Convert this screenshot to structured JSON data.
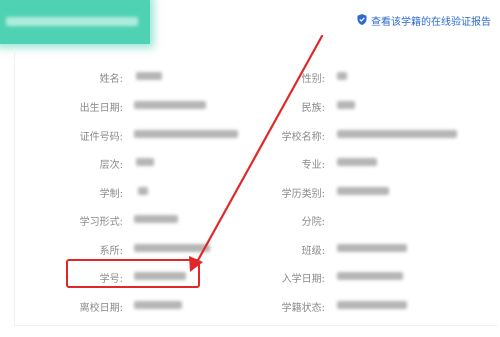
{
  "header": {
    "verify_link_label": "查看该学籍的在线验证报告",
    "verify_icon": "shield-check-icon",
    "accent_color": "#2e6bcf",
    "banner_color": "#4fd2b3"
  },
  "fields": {
    "left": [
      {
        "key": "name",
        "label": "姓名:"
      },
      {
        "key": "birthdate",
        "label": "出生日期:"
      },
      {
        "key": "id_number",
        "label": "证件号码:"
      },
      {
        "key": "level",
        "label": "层次:"
      },
      {
        "key": "duration",
        "label": "学制:"
      },
      {
        "key": "study_form",
        "label": "学习形式:"
      },
      {
        "key": "department",
        "label": "系所:"
      },
      {
        "key": "student_id",
        "label": "学号:"
      },
      {
        "key": "leave_date",
        "label": "离校日期:"
      }
    ],
    "right": [
      {
        "key": "gender",
        "label": "性别:"
      },
      {
        "key": "ethnicity",
        "label": "民族:"
      },
      {
        "key": "school",
        "label": "学校名称:"
      },
      {
        "key": "major",
        "label": "专业:"
      },
      {
        "key": "degree_type",
        "label": "学历类别:"
      },
      {
        "key": "branch",
        "label": "分院:"
      },
      {
        "key": "class",
        "label": "班级:"
      },
      {
        "key": "enroll_date",
        "label": "入学日期:"
      },
      {
        "key": "status",
        "label": "学籍状态:"
      }
    ]
  },
  "annotation": {
    "highlight_color": "#e0282a",
    "highlighted_field": "student_id"
  }
}
